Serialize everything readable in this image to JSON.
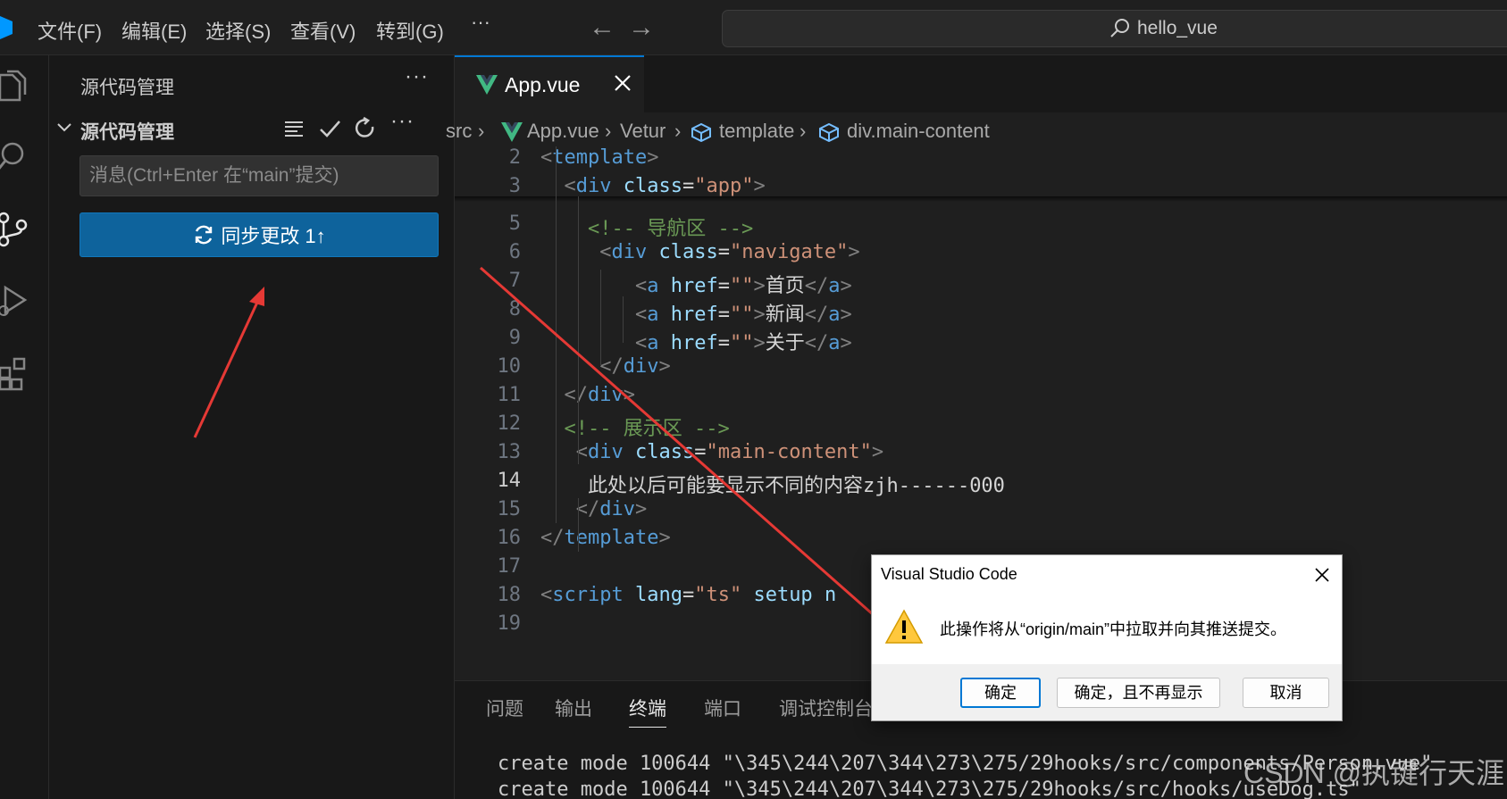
{
  "menubar": {
    "items": [
      "文件(F)",
      "编辑(E)",
      "选择(S)",
      "查看(V)",
      "转到(G)"
    ],
    "more": "···",
    "back": "←",
    "forward": "→",
    "search_label": "hello_vue"
  },
  "activity_bar": {
    "icons": [
      "explorer-icon",
      "search-icon",
      "source-control-icon",
      "run-debug-icon",
      "extensions-icon"
    ]
  },
  "sidebar": {
    "title": "源代码管理",
    "more": "···",
    "section_title": "源代码管理",
    "commit_placeholder": "消息(Ctrl+Enter 在“main”提交)",
    "sync_button_label": "同步更改 1↑"
  },
  "editor": {
    "tab_label": "App.vue",
    "breadcrumb": [
      "src",
      "App.vue",
      "Vetur",
      "template",
      "div.main-content"
    ],
    "active_line": 14,
    "lines": [
      {
        "n": "2",
        "tokens": [
          [
            "b",
            "<"
          ],
          [
            "t",
            "template"
          ],
          [
            "b",
            ">"
          ]
        ]
      },
      {
        "n": "3",
        "tokens": [
          [
            "s",
            "  "
          ],
          [
            "b",
            "<"
          ],
          [
            "t",
            "div"
          ],
          [
            "s",
            " "
          ],
          [
            "a",
            "class"
          ],
          [
            "x",
            "="
          ],
          [
            "r",
            "\"app\""
          ],
          [
            "b",
            ">"
          ]
        ]
      },
      {
        "n": "5",
        "tokens": [
          [
            "s",
            "    "
          ],
          [
            "c",
            "<!-- 导航区 -->"
          ]
        ]
      },
      {
        "n": "6",
        "tokens": [
          [
            "s",
            "     "
          ],
          [
            "b",
            "<"
          ],
          [
            "t",
            "div"
          ],
          [
            "s",
            " "
          ],
          [
            "a",
            "class"
          ],
          [
            "x",
            "="
          ],
          [
            "r",
            "\"navigate\""
          ],
          [
            "b",
            ">"
          ]
        ]
      },
      {
        "n": "7",
        "tokens": [
          [
            "s",
            "        "
          ],
          [
            "b",
            "<"
          ],
          [
            "t",
            "a"
          ],
          [
            "s",
            " "
          ],
          [
            "a",
            "href"
          ],
          [
            "x",
            "="
          ],
          [
            "r",
            "\"\""
          ],
          [
            "b",
            ">"
          ],
          [
            "x",
            "首页"
          ],
          [
            "b",
            "</"
          ],
          [
            "t",
            "a"
          ],
          [
            "b",
            ">"
          ]
        ]
      },
      {
        "n": "8",
        "tokens": [
          [
            "s",
            "        "
          ],
          [
            "b",
            "<"
          ],
          [
            "t",
            "a"
          ],
          [
            "s",
            " "
          ],
          [
            "a",
            "href"
          ],
          [
            "x",
            "="
          ],
          [
            "r",
            "\"\""
          ],
          [
            "b",
            ">"
          ],
          [
            "x",
            "新闻"
          ],
          [
            "b",
            "</"
          ],
          [
            "t",
            "a"
          ],
          [
            "b",
            ">"
          ]
        ]
      },
      {
        "n": "9",
        "tokens": [
          [
            "s",
            "        "
          ],
          [
            "b",
            "<"
          ],
          [
            "t",
            "a"
          ],
          [
            "s",
            " "
          ],
          [
            "a",
            "href"
          ],
          [
            "x",
            "="
          ],
          [
            "r",
            "\"\""
          ],
          [
            "b",
            ">"
          ],
          [
            "x",
            "关于"
          ],
          [
            "b",
            "</"
          ],
          [
            "t",
            "a"
          ],
          [
            "b",
            ">"
          ]
        ]
      },
      {
        "n": "10",
        "tokens": [
          [
            "s",
            "     "
          ],
          [
            "b",
            "</"
          ],
          [
            "t",
            "div"
          ],
          [
            "b",
            ">"
          ]
        ]
      },
      {
        "n": "11",
        "tokens": [
          [
            "s",
            "  "
          ],
          [
            "b",
            "</"
          ],
          [
            "t",
            "div"
          ],
          [
            "b",
            ">"
          ]
        ]
      },
      {
        "n": "12",
        "tokens": [
          [
            "s",
            "  "
          ],
          [
            "c",
            "<!-- 展示区 -->"
          ]
        ]
      },
      {
        "n": "13",
        "tokens": [
          [
            "s",
            "   "
          ],
          [
            "b",
            "<"
          ],
          [
            "t",
            "div"
          ],
          [
            "s",
            " "
          ],
          [
            "a",
            "class"
          ],
          [
            "x",
            "="
          ],
          [
            "r",
            "\"main-content\""
          ],
          [
            "b",
            ">"
          ]
        ]
      },
      {
        "n": "14",
        "tokens": [
          [
            "s",
            "    "
          ],
          [
            "x",
            "此处以后可能要显示不同的内容zjh------000"
          ]
        ]
      },
      {
        "n": "15",
        "tokens": [
          [
            "s",
            "   "
          ],
          [
            "b",
            "</"
          ],
          [
            "t",
            "div"
          ],
          [
            "b",
            ">"
          ]
        ]
      },
      {
        "n": "16",
        "tokens": [
          [
            "b",
            "</"
          ],
          [
            "t",
            "template"
          ],
          [
            "b",
            ">"
          ]
        ]
      },
      {
        "n": "17",
        "tokens": []
      },
      {
        "n": "18",
        "tokens": [
          [
            "b",
            "<"
          ],
          [
            "t",
            "script"
          ],
          [
            "s",
            " "
          ],
          [
            "a",
            "lang"
          ],
          [
            "x",
            "="
          ],
          [
            "r",
            "\"ts\""
          ],
          [
            "s",
            " "
          ],
          [
            "a",
            "setup"
          ],
          [
            "s",
            " "
          ],
          [
            "a",
            "n"
          ]
        ]
      },
      {
        "n": "19",
        "tokens": []
      }
    ]
  },
  "panel": {
    "tabs": [
      "问题",
      "输出",
      "终端",
      "端口",
      "调试控制台"
    ],
    "active_tab": "终端",
    "terminal_lines": [
      "create mode 100644 \"\\345\\244\\207\\344\\273\\275/29hooks/src/components/Person.vue\"",
      "create mode 100644 \"\\345\\244\\207\\344\\273\\275/29hooks/src/hooks/useDog.ts\""
    ]
  },
  "dialog": {
    "title": "Visual Studio Code",
    "message": "此操作将从“origin/main”中拉取并向其推送提交。",
    "buttons": {
      "ok": "确定",
      "ok_dont_show": "确定，且不再显示",
      "cancel": "取消"
    }
  },
  "watermark": "CSDN @执键行天涯",
  "colors": {
    "accent": "#0078d4",
    "sync_button": "#0e639c",
    "annotation_arrow": "#e53935",
    "vue_logo": "#41b883"
  }
}
